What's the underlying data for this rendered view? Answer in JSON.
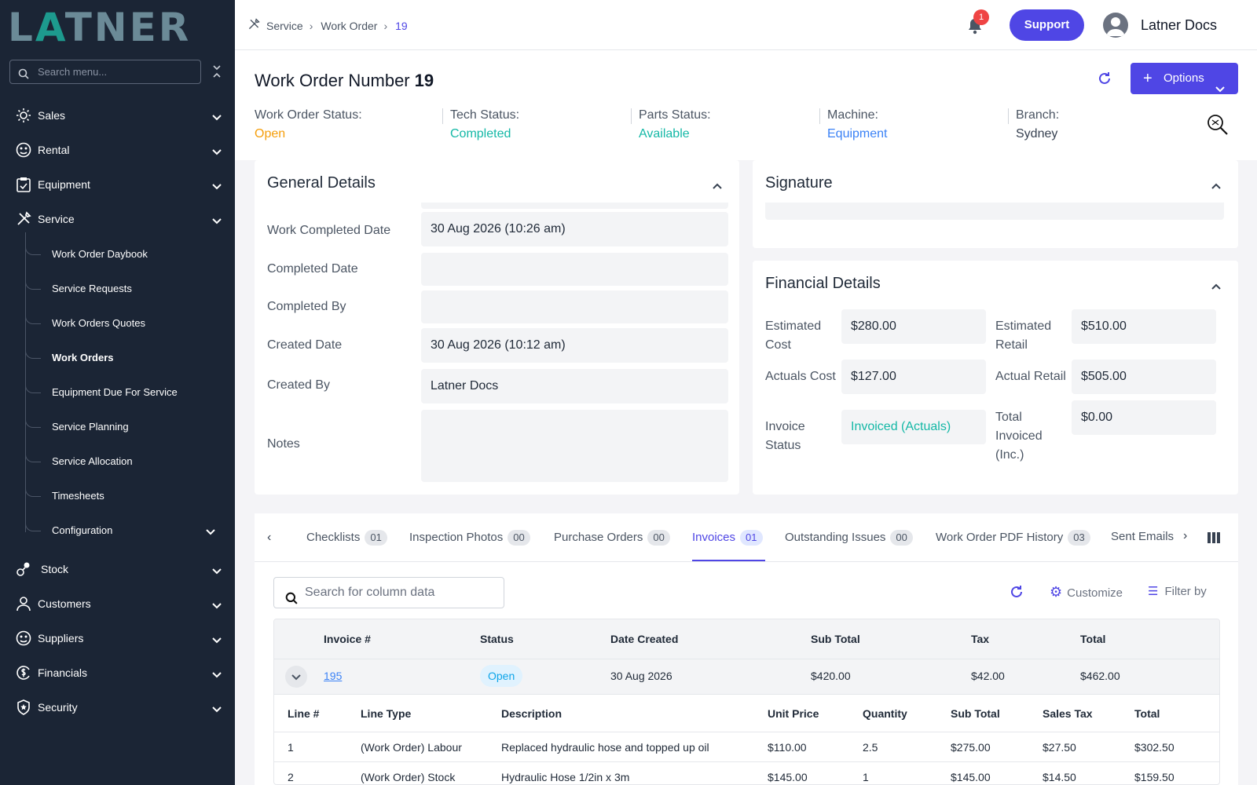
{
  "brand": {
    "logo_pre": "L",
    "logo_a": "A",
    "logo_post": "TNER"
  },
  "sidebar": {
    "search_placeholder": "Search menu...",
    "items": [
      {
        "label": "Sales",
        "icon": "settings-sun-icon"
      },
      {
        "label": "Rental",
        "icon": "rental-icon"
      },
      {
        "label": "Equipment",
        "icon": "clipboard-icon"
      },
      {
        "label": "Service",
        "icon": "tools-icon"
      },
      {
        "label": "Stock",
        "icon": "stock-icon"
      },
      {
        "label": "Customers",
        "icon": "user-icon"
      },
      {
        "label": "Suppliers",
        "icon": "supplier-icon"
      },
      {
        "label": "Financials",
        "icon": "dollar-icon"
      },
      {
        "label": "Security",
        "icon": "shield-icon"
      }
    ],
    "service_sub": [
      {
        "label": "Work Order Daybook"
      },
      {
        "label": "Service Requests"
      },
      {
        "label": "Work Orders Quotes"
      },
      {
        "label": "Work Orders"
      },
      {
        "label": "Equipment Due For Service"
      },
      {
        "label": "Service Planning"
      },
      {
        "label": "Service Allocation"
      },
      {
        "label": "Timesheets"
      },
      {
        "label": "Configuration"
      }
    ]
  },
  "topbar": {
    "breadcrumb": [
      "Service",
      "Work Order",
      "19"
    ],
    "notification_count": "1",
    "support_label": "Support",
    "user_name": "Latner Docs"
  },
  "header": {
    "title_label": "Work Order Number",
    "title_number": "19",
    "options_label": "Options",
    "stats": [
      {
        "key": "Work Order Status:",
        "value": "Open",
        "color": "#f59e0b"
      },
      {
        "key": "Tech Status:",
        "value": "Completed",
        "color": "#14b8a6"
      },
      {
        "key": "Parts Status:",
        "value": "Available",
        "color": "#14b8a6"
      },
      {
        "key": "Machine:",
        "value": "Equipment",
        "color": "#3b82f6"
      },
      {
        "key": "Branch:",
        "value": "Sydney",
        "color": "#374151"
      }
    ]
  },
  "general": {
    "title": "General Details",
    "fields": [
      {
        "label": "Work Completed Date",
        "value": "30 Aug 2026 (10:26 am)"
      },
      {
        "label": "Completed Date",
        "value": ""
      },
      {
        "label": "Completed By",
        "value": ""
      },
      {
        "label": "Created Date",
        "value": "30 Aug 2026 (10:12 am)"
      },
      {
        "label": "Created By",
        "value": "Latner Docs"
      },
      {
        "label": "Notes",
        "value": ""
      }
    ]
  },
  "signature": {
    "title": "Signature"
  },
  "financial": {
    "title": "Financial Details",
    "estimated_cost_label": "Estimated Cost",
    "estimated_cost": "$280.00",
    "estimated_retail_label": "Estimated Retail",
    "estimated_retail": "$510.00",
    "actuals_cost_label": "Actuals Cost",
    "actuals_cost": "$127.00",
    "actual_retail_label": "Actual Retail",
    "actual_retail": "$505.00",
    "invoice_status_label": "Invoice Status",
    "invoice_status": "Invoiced (Actuals)",
    "total_invoiced_label": "Total Invoiced (Inc.)",
    "total_invoiced": "$0.00"
  },
  "tabs": [
    {
      "label": "Checklists",
      "count": "01"
    },
    {
      "label": "Inspection Photos",
      "count": "00"
    },
    {
      "label": "Purchase Orders",
      "count": "00"
    },
    {
      "label": "Invoices",
      "count": "01"
    },
    {
      "label": "Outstanding Issues",
      "count": "00"
    },
    {
      "label": "Work Order PDF History",
      "count": "03"
    },
    {
      "label": "Sent Emails",
      "count": ""
    }
  ],
  "invoices": {
    "search_placeholder": "Search for column data",
    "customize_label": "Customize",
    "filter_label": "Filter by",
    "columns": [
      "Invoice #",
      "Status",
      "Date Created",
      "Sub Total",
      "Tax",
      "Total"
    ],
    "rows": [
      {
        "invoice": "195",
        "status": "Open",
        "date": "30 Aug 2026",
        "subtotal": "$420.00",
        "tax": "$42.00",
        "total": "$462.00"
      }
    ],
    "line_columns": [
      "Line #",
      "Line Type",
      "Description",
      "Unit Price",
      "Quantity",
      "Sub Total",
      "Sales Tax",
      "Total"
    ],
    "lines": [
      {
        "line": "1",
        "type": "(Work Order) Labour",
        "desc": "Replaced hydraulic hose and topped up oil",
        "unit": "$110.00",
        "qty": "2.5",
        "sub": "$275.00",
        "tax": "$27.50",
        "total": "$302.50"
      },
      {
        "line": "2",
        "type": "(Work Order) Stock",
        "desc": "Hydraulic Hose 1/2in x 3m",
        "unit": "$145.00",
        "qty": "1",
        "sub": "$145.00",
        "tax": "$14.50",
        "total": "$159.50"
      }
    ]
  }
}
